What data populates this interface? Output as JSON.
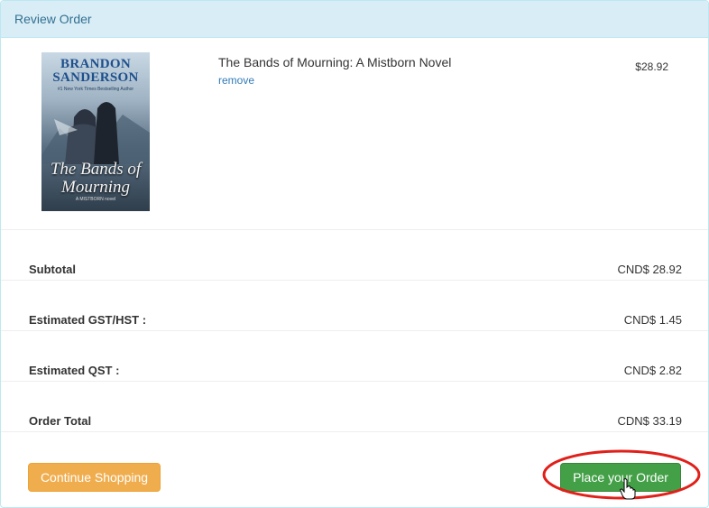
{
  "panel": {
    "heading": "Review Order"
  },
  "item": {
    "cover": {
      "author_line1": "BRANDON",
      "author_line2": "SANDERSON",
      "tagline": "#1 New York Times Bestselling Author",
      "title_line1": "The Bands of",
      "title_line2": "Mourning",
      "subtag": "A MISTBORN novel"
    },
    "title": "The Bands of Mourning: A Mistborn Novel",
    "remove_label": "remove",
    "price": "$28.92"
  },
  "summary": [
    {
      "label": "Subtotal",
      "value": "CND$ 28.92"
    },
    {
      "label": "Estimated GST/HST :",
      "value": "CND$ 1.45"
    },
    {
      "label": "Estimated QST :",
      "value": "CND$ 2.82"
    },
    {
      "label": "Order Total",
      "value": "CDN$ 33.19"
    }
  ],
  "actions": {
    "continue_label": "Continue Shopping",
    "place_label": "Place your Order"
  },
  "colors": {
    "heading_bg": "#d9edf7",
    "continue_btn": "#f0ad4e",
    "place_btn": "#43a047",
    "highlight_circle": "#e0201a",
    "link": "#337ab7"
  }
}
